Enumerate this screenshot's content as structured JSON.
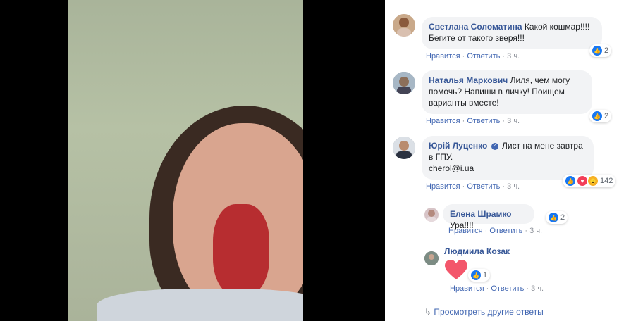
{
  "comments": [
    {
      "name": "Светлана Соломатина",
      "text": "Какой кошмар!!!! Бегите от такого зверя!!!",
      "like": "Нравится",
      "reply": "Ответить",
      "time": "3 ч.",
      "reactions": "2"
    },
    {
      "name": "Наталья Маркович",
      "text": "Лиля, чем могу помочь? Напиши в личку! Поищем варианты вместе!",
      "like": "Нравится",
      "reply": "Ответить",
      "time": "3 ч.",
      "reactions": "2"
    },
    {
      "name": "Юрій Луценко",
      "text": "Лист на мене завтра в ГПУ.",
      "text2": "cherol@i.ua",
      "like": "Нравится",
      "reply": "Ответить",
      "time": "3 ч.",
      "reactions": "142"
    }
  ],
  "replies": [
    {
      "name": "Елена Шрамко",
      "text": "Ура!!!!",
      "like": "Нравится",
      "reply": "Ответить",
      "time": "3 ч.",
      "reactions": "2"
    },
    {
      "name": "Людмила Козак",
      "like": "Нравится",
      "reply": "Ответить",
      "time": "3 ч.",
      "reactions": "1"
    }
  ],
  "more_replies": "Просмотреть другие ответы",
  "icons": {
    "like": "thumbs-up-icon",
    "love": "heart-icon",
    "wow": "wow-icon",
    "verified": "verified-icon",
    "reply_arrow": "reply-arrow-icon"
  },
  "colors": {
    "link": "#385898",
    "like_blue": "#1877f2",
    "heart": "#f33e58"
  }
}
